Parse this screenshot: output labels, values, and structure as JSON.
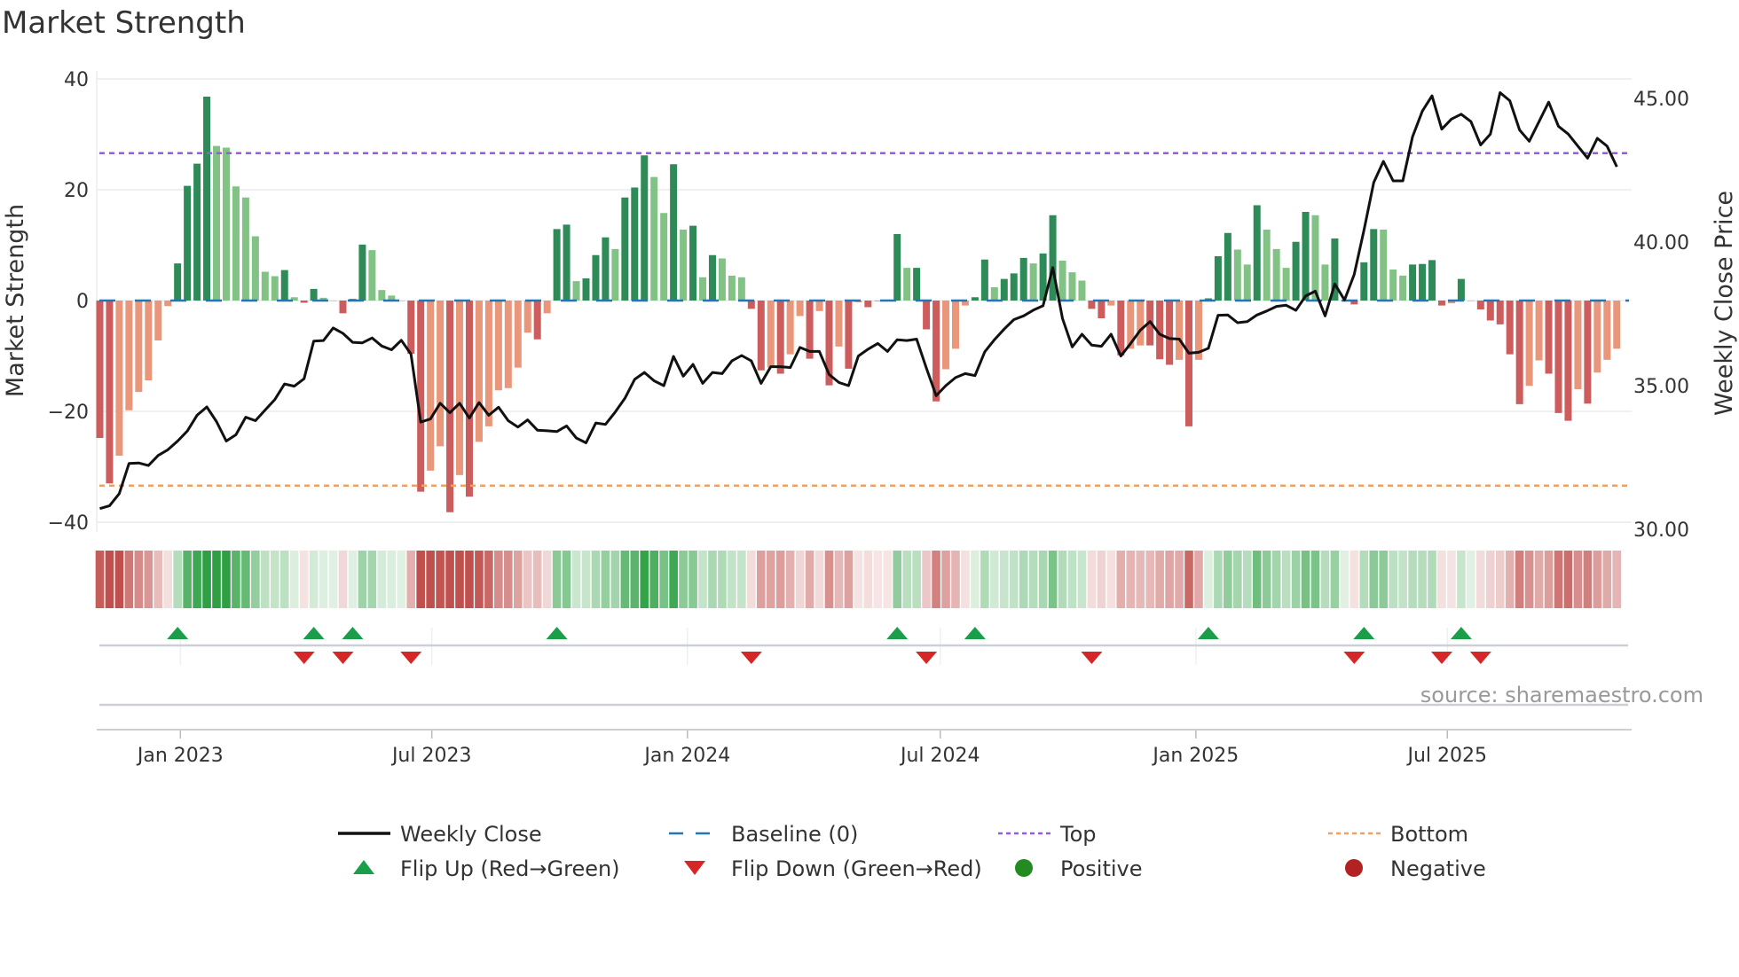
{
  "title": "Market Strength",
  "source": "source: sharemaestro.com",
  "chart_data": {
    "type": "bar",
    "title": "Market Strength",
    "ylabel": "Market Strength",
    "ylabel_right": "Weekly Close Price",
    "ylim": [
      -40,
      40
    ],
    "ylim_right": [
      30,
      45
    ],
    "yticks": [
      {
        "v": 40,
        "label": "40"
      },
      {
        "v": 20,
        "label": "20"
      },
      {
        "v": 0,
        "label": "0"
      },
      {
        "v": -20,
        "label": "−20"
      },
      {
        "v": -40,
        "label": "−40"
      }
    ],
    "yticks_right": [
      {
        "v": 45,
        "label": "45.00"
      },
      {
        "v": 40,
        "label": "40.00"
      },
      {
        "v": 35,
        "label": "35.00"
      },
      {
        "v": 30,
        "label": "30.00"
      }
    ],
    "xticks": [
      {
        "date": "2023-01-01",
        "label": "Jan 2023"
      },
      {
        "date": "2023-07-01",
        "label": "Jul 2023"
      },
      {
        "date": "2024-01-01",
        "label": "Jan 2024"
      },
      {
        "date": "2024-07-01",
        "label": "Jul 2024"
      },
      {
        "date": "2025-01-01",
        "label": "Jan 2025"
      },
      {
        "date": "2025-07-01",
        "label": "Jul 2025"
      }
    ],
    "start_date": "2022-11-04",
    "interval": "weekly",
    "top_level": 26.6,
    "bottom_level": -33.4,
    "baseline": 0,
    "grid": true,
    "legend_position": "bottom",
    "strength": [
      -24.8,
      -33,
      -28,
      -19.8,
      -16.5,
      -14.4,
      -7.2,
      -1,
      6.7,
      20.7,
      24.7,
      36.8,
      27.9,
      27.6,
      20.6,
      18.6,
      11.6,
      5.2,
      4.4,
      5.5,
      0.6,
      -0.4,
      2.1,
      0.5,
      0,
      -2.3,
      0.3,
      10.1,
      9.1,
      1.9,
      0.9,
      0,
      -9.6,
      -34.5,
      -30.7,
      -26.3,
      -38.2,
      -31.5,
      -35.4,
      -25.5,
      -22.7,
      -16.2,
      -15.8,
      -12.1,
      -5.8,
      -7,
      -2.3,
      12.9,
      13.7,
      3.5,
      4,
      8.2,
      11.4,
      9.3,
      18.6,
      20.4,
      26.2,
      22.3,
      15.8,
      24.6,
      12.8,
      13.5,
      4.2,
      8.2,
      7.6,
      4.5,
      4.2,
      -1.5,
      -12.6,
      -12.1,
      -13.2,
      -9.7,
      -2.8,
      -10.5,
      -1.9,
      -15.3,
      -8.3,
      -12.3,
      -0.3,
      -1.2,
      0,
      0,
      12,
      5.9,
      5.9,
      -5.2,
      -18.2,
      -12.4,
      -8.7,
      -0.9,
      0.6,
      7.4,
      2.4,
      3.9,
      4.9,
      7.7,
      6.7,
      8.5,
      15.4,
      7.2,
      5.1,
      3.6,
      -1.5,
      -3.2,
      -0.9,
      -9.9,
      -8.7,
      -8.1,
      -8.1,
      -10.6,
      -11.6,
      -10.7,
      -22.7,
      -10.7,
      0.4,
      8,
      12.2,
      9.2,
      6.5,
      17.2,
      12.8,
      9.3,
      5.9,
      10.6,
      16,
      15.4,
      6.5,
      11.2,
      0,
      -0.7,
      6.9,
      12.9,
      12.8,
      5.6,
      4.5,
      6.5,
      6.6,
      7.3,
      -0.9,
      -0.5,
      3.9,
      0,
      -1.6,
      -3.6,
      -4.3,
      -9.7,
      -18.7,
      -15.4,
      -10.8,
      -13.2,
      -20.3,
      -21.7,
      -16,
      -18.6,
      -13,
      -10.7,
      -8.7
    ],
    "weekly_close": [
      30.72,
      30.82,
      31.24,
      32.29,
      32.31,
      32.22,
      32.57,
      32.77,
      33.07,
      33.42,
      33.97,
      34.26,
      33.75,
      33.07,
      33.29,
      33.9,
      33.78,
      34.15,
      34.52,
      35.06,
      34.98,
      35.24,
      36.55,
      36.57,
      37.01,
      36.82,
      36.51,
      36.49,
      36.66,
      36.38,
      36.25,
      36.58,
      36.1,
      33.73,
      33.84,
      34.39,
      34.06,
      34.39,
      33.87,
      34.41,
      33.97,
      34.25,
      33.78,
      33.56,
      33.81,
      33.45,
      33.43,
      33.4,
      33.6,
      33.18,
      33.01,
      33.7,
      33.65,
      34.08,
      34.56,
      35.22,
      35.46,
      35.17,
      35.0,
      36.02,
      35.33,
      35.74,
      35.08,
      35.46,
      35.42,
      35.86,
      36.05,
      35.86,
      35.08,
      35.66,
      35.66,
      35.63,
      36.33,
      36.19,
      36.19,
      35.39,
      35.11,
      35.0,
      36.03,
      36.27,
      36.47,
      36.19,
      36.6,
      36.57,
      36.62,
      35.61,
      34.65,
      35.0,
      35.28,
      35.42,
      35.35,
      36.18,
      36.6,
      36.97,
      37.3,
      37.43,
      37.63,
      37.78,
      39.11,
      37.34,
      36.35,
      36.79,
      36.41,
      36.37,
      36.79,
      36.03,
      36.47,
      36.93,
      37.23,
      36.79,
      36.64,
      36.62,
      36.13,
      36.16,
      36.3,
      37.45,
      37.46,
      37.19,
      37.23,
      37.46,
      37.6,
      37.76,
      37.8,
      37.62,
      38.12,
      38.29,
      37.43,
      38.54,
      37.98,
      38.87,
      40.41,
      42.07,
      42.81,
      42.13,
      42.13,
      43.67,
      44.56,
      45.09,
      43.93,
      44.28,
      44.45,
      44.19,
      43.38,
      43.76,
      45.2,
      44.92,
      43.9,
      43.51,
      44.19,
      44.87,
      44.03,
      43.76,
      43.34,
      42.92,
      43.61,
      43.34,
      42.62
    ],
    "flip_up_weeks": [
      8,
      22,
      26,
      47,
      82,
      90,
      114,
      130,
      140
    ],
    "flip_down_weeks": [
      21,
      25,
      32,
      67,
      85,
      102,
      129,
      138,
      142
    ],
    "colors": {
      "rising_positive": "#2e8b57",
      "fading_positive": "#82c385",
      "rising_negative": "#cd5c5c",
      "fading_negative": "#e9967a",
      "top": "#9b59e0",
      "bottom": "#f0a060",
      "baseline": "#1f77b4",
      "close": "#111111",
      "flip_up": "#1a9e4a",
      "flip_down": "#d62728",
      "positive": "#228b22",
      "negative": "#b22222"
    },
    "legend": [
      {
        "key": "close",
        "label": "Weekly Close",
        "kind": "line"
      },
      {
        "key": "baseline",
        "label": "Baseline (0)",
        "kind": "dash"
      },
      {
        "key": "top",
        "label": "Top",
        "kind": "dot"
      },
      {
        "key": "bottom",
        "label": "Bottom",
        "kind": "dot"
      },
      {
        "key": "flip_up",
        "label": "Flip Up (Red→Green)",
        "kind": "tri-up"
      },
      {
        "key": "flip_down",
        "label": "Flip Down (Green→Red)",
        "kind": "tri-down"
      },
      {
        "key": "positive",
        "label": "Positive",
        "kind": "circle"
      },
      {
        "key": "negative",
        "label": "Negative",
        "kind": "circle"
      }
    ]
  }
}
